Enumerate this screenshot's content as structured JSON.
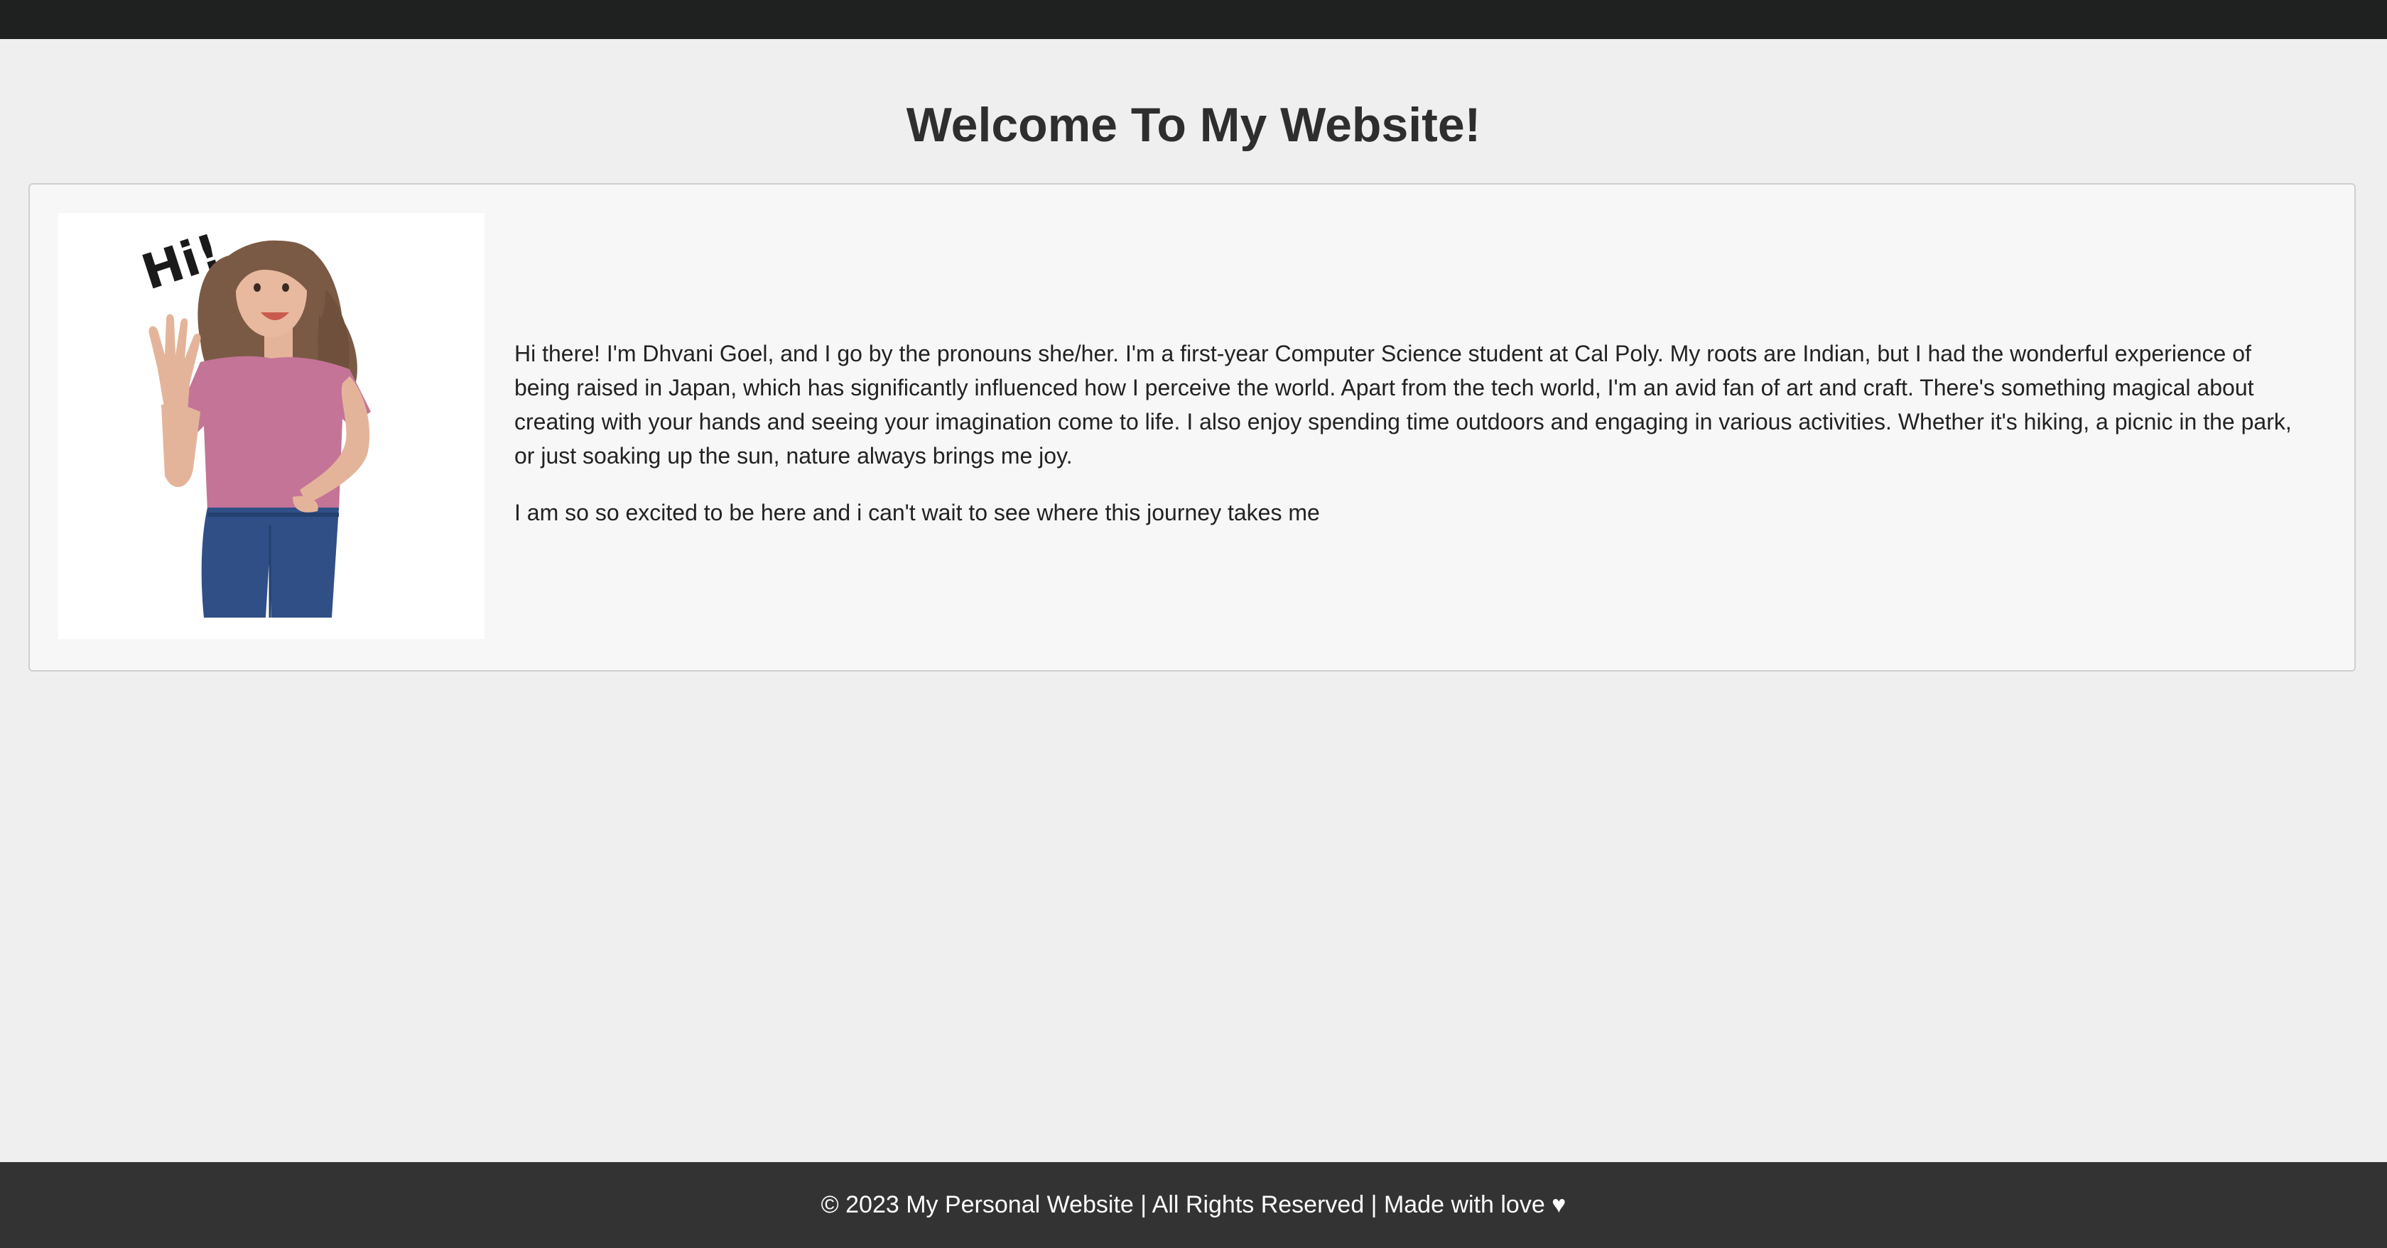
{
  "header": {
    "title": "Welcome To My Website!"
  },
  "profile": {
    "image_alt": "Cartoon of a waving girl saying Hi!",
    "greeting": "Hi!",
    "bio_paragraph_1": "Hi there! I'm Dhvani Goel, and I go by the pronouns she/her. I'm a first-year Computer Science student at Cal Poly. My roots are Indian, but I had the wonderful experience of being raised in Japan, which has significantly influenced how I perceive the world. Apart from the tech world, I'm an avid fan of art and craft. There's something magical about creating with your hands and seeing your imagination come to life. I also enjoy spending time outdoors and engaging in various activities. Whether it's hiking, a picnic in the park, or just soaking up the sun, nature always brings me joy.",
    "bio_paragraph_2": "I am so so excited to be here and i can't wait to see where this journey takes me"
  },
  "footer": {
    "text": "© 2023 My Personal Website | All Rights Reserved | Made with love ♥"
  },
  "colors": {
    "topbar": "#1f2020",
    "background": "#efefef",
    "card": "#f7f7f7",
    "footer": "#333333",
    "title": "#2e2e2e"
  }
}
